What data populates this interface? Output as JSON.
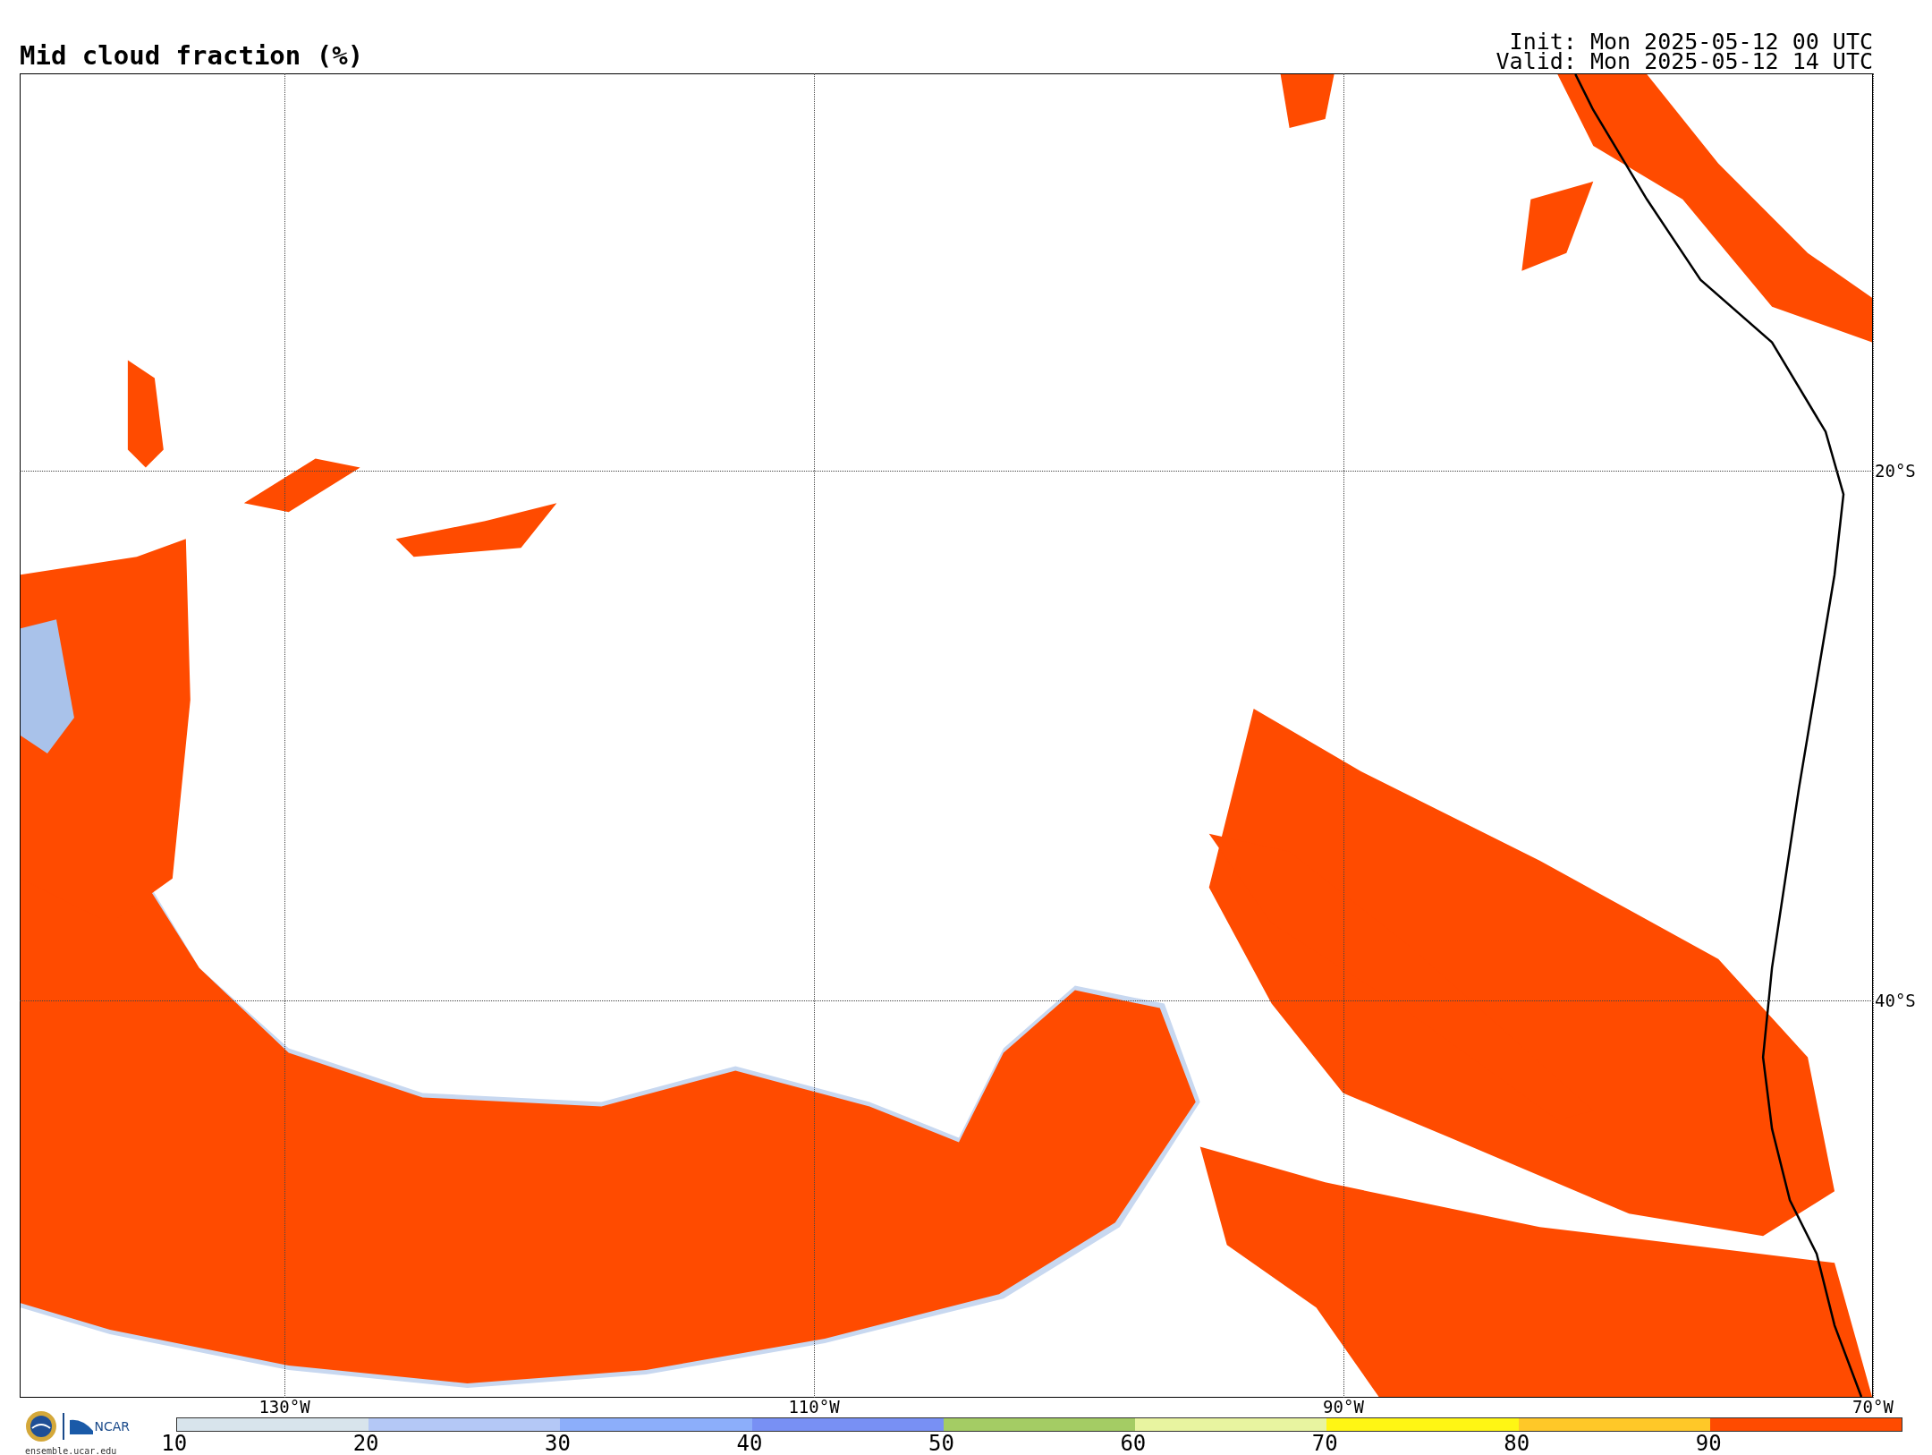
{
  "title": "Mid cloud fraction (%)",
  "init": "Init: Mon 2025-05-12 00 UTC",
  "valid": "Valid: Mon 2025-05-12 14 UTC",
  "map": {
    "lat_labels": [
      "20°S",
      "40°S"
    ],
    "lon_labels": [
      "130°W",
      "110°W",
      "90°W",
      "70°W"
    ]
  },
  "logo": {
    "name": "NCAR",
    "site": "ensemble.ucar.edu"
  },
  "colorbar": {
    "segments": [
      {
        "color": "#d8e4ec"
      },
      {
        "color": "#b4c8f6"
      },
      {
        "color": "#8caefa"
      },
      {
        "color": "#7890f4"
      },
      {
        "color": "#a4cc64"
      },
      {
        "color": "#e8f4a0"
      },
      {
        "color": "#fff614"
      },
      {
        "color": "#ffc828"
      },
      {
        "color": "#ff4b00"
      }
    ],
    "ticks": [
      "10",
      "20",
      "30",
      "40",
      "50",
      "60",
      "70",
      "80",
      "90"
    ]
  }
}
